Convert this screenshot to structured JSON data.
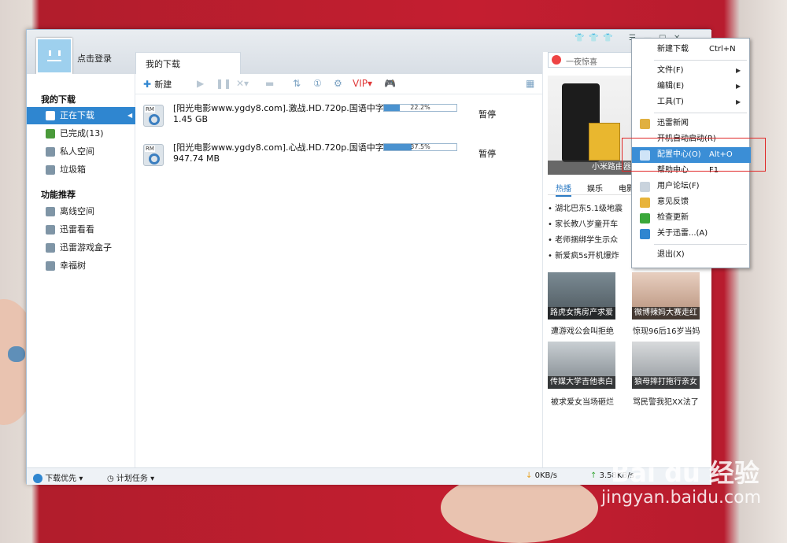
{
  "window": {
    "user": {
      "login_label": "点击登录"
    },
    "tab": {
      "label": "我的下载"
    },
    "toolbar": {
      "new_label": "新建"
    },
    "sidebar": {
      "section1": "我的下载",
      "items": [
        {
          "label": "正在下载"
        },
        {
          "label": "已完成(13)"
        },
        {
          "label": "私人空间"
        },
        {
          "label": "垃圾箱"
        }
      ],
      "section2": "功能推荐",
      "features": [
        {
          "label": "离线空间"
        },
        {
          "label": "迅雷看看"
        },
        {
          "label": "迅雷游戏盒子"
        },
        {
          "label": "幸福树"
        }
      ]
    },
    "downloads": [
      {
        "name": "[阳光电影www.ygdy8.com].激战.HD.720p.国语中字.rmvb",
        "size": "1.45 GB",
        "percent_text": "22.2%",
        "progress": 0.222,
        "status": "暂停"
      },
      {
        "name": "[阳光电影www.ygdy8.com].心战.HD.720p.国语中字.rmvb",
        "size": "947.74 MB",
        "percent_text": "37.5%",
        "progress": 0.375,
        "status": "暂停"
      }
    ],
    "right_panel": {
      "search_text": "一夜惊喜",
      "banner_caption": "小米路由器",
      "tabs": [
        {
          "label": "热播"
        },
        {
          "label": "娱乐"
        },
        {
          "label": "电影"
        }
      ],
      "news": [
        "湖北巴东5.1级地震",
        "家长教八岁童开车",
        "老师捆绑学生示众",
        "新爱疯5s开机爆炸"
      ],
      "thumbs": [
        {
          "caption": "路虎女携房产求爱",
          "sub": "遭游戏公会叫拒绝"
        },
        {
          "caption": "微博辣妈大赛走红",
          "sub": "惊现96后16岁当妈"
        },
        {
          "caption": "传媒大学吉他表白",
          "sub": "被求爱女当场砸烂"
        },
        {
          "caption": "狼母摔打拖行亲女",
          "sub": "骂民警我犯XX法了"
        }
      ]
    },
    "statusbar": {
      "priority": "下载优先",
      "schedule": "计划任务",
      "down_speed": "0KB/s",
      "up_speed": "3.58KB/s"
    }
  },
  "context_menu": {
    "items": [
      {
        "label": "新建下载",
        "shortcut": "Ctrl+N"
      },
      {
        "label": "文件(F)",
        "submenu": "▶"
      },
      {
        "label": "编辑(E)",
        "submenu": "▶"
      },
      {
        "label": "工具(T)",
        "submenu": "▶"
      },
      {
        "label": "迅雷新闻",
        "icon": "news-icon"
      },
      {
        "label": "开机自动启动(R)"
      },
      {
        "label": "配置中心(O)",
        "shortcut": "Alt+O",
        "icon": "gear-icon"
      },
      {
        "label": "帮助中心",
        "shortcut": "F1"
      },
      {
        "label": "用户论坛(F)",
        "icon": "forum-icon"
      },
      {
        "label": "意见反馈",
        "icon": "mail-icon"
      },
      {
        "label": "检查更新",
        "icon": "update-icon"
      },
      {
        "label": "关于迅雷...(A)",
        "icon": "info-icon"
      },
      {
        "label": "退出(X)"
      }
    ]
  },
  "watermark": {
    "logo": "Bai du 经验",
    "url": "jingyan.baidu.com"
  },
  "colors": {
    "accent": "#2f86d0",
    "highlight_box": "#e02828"
  }
}
